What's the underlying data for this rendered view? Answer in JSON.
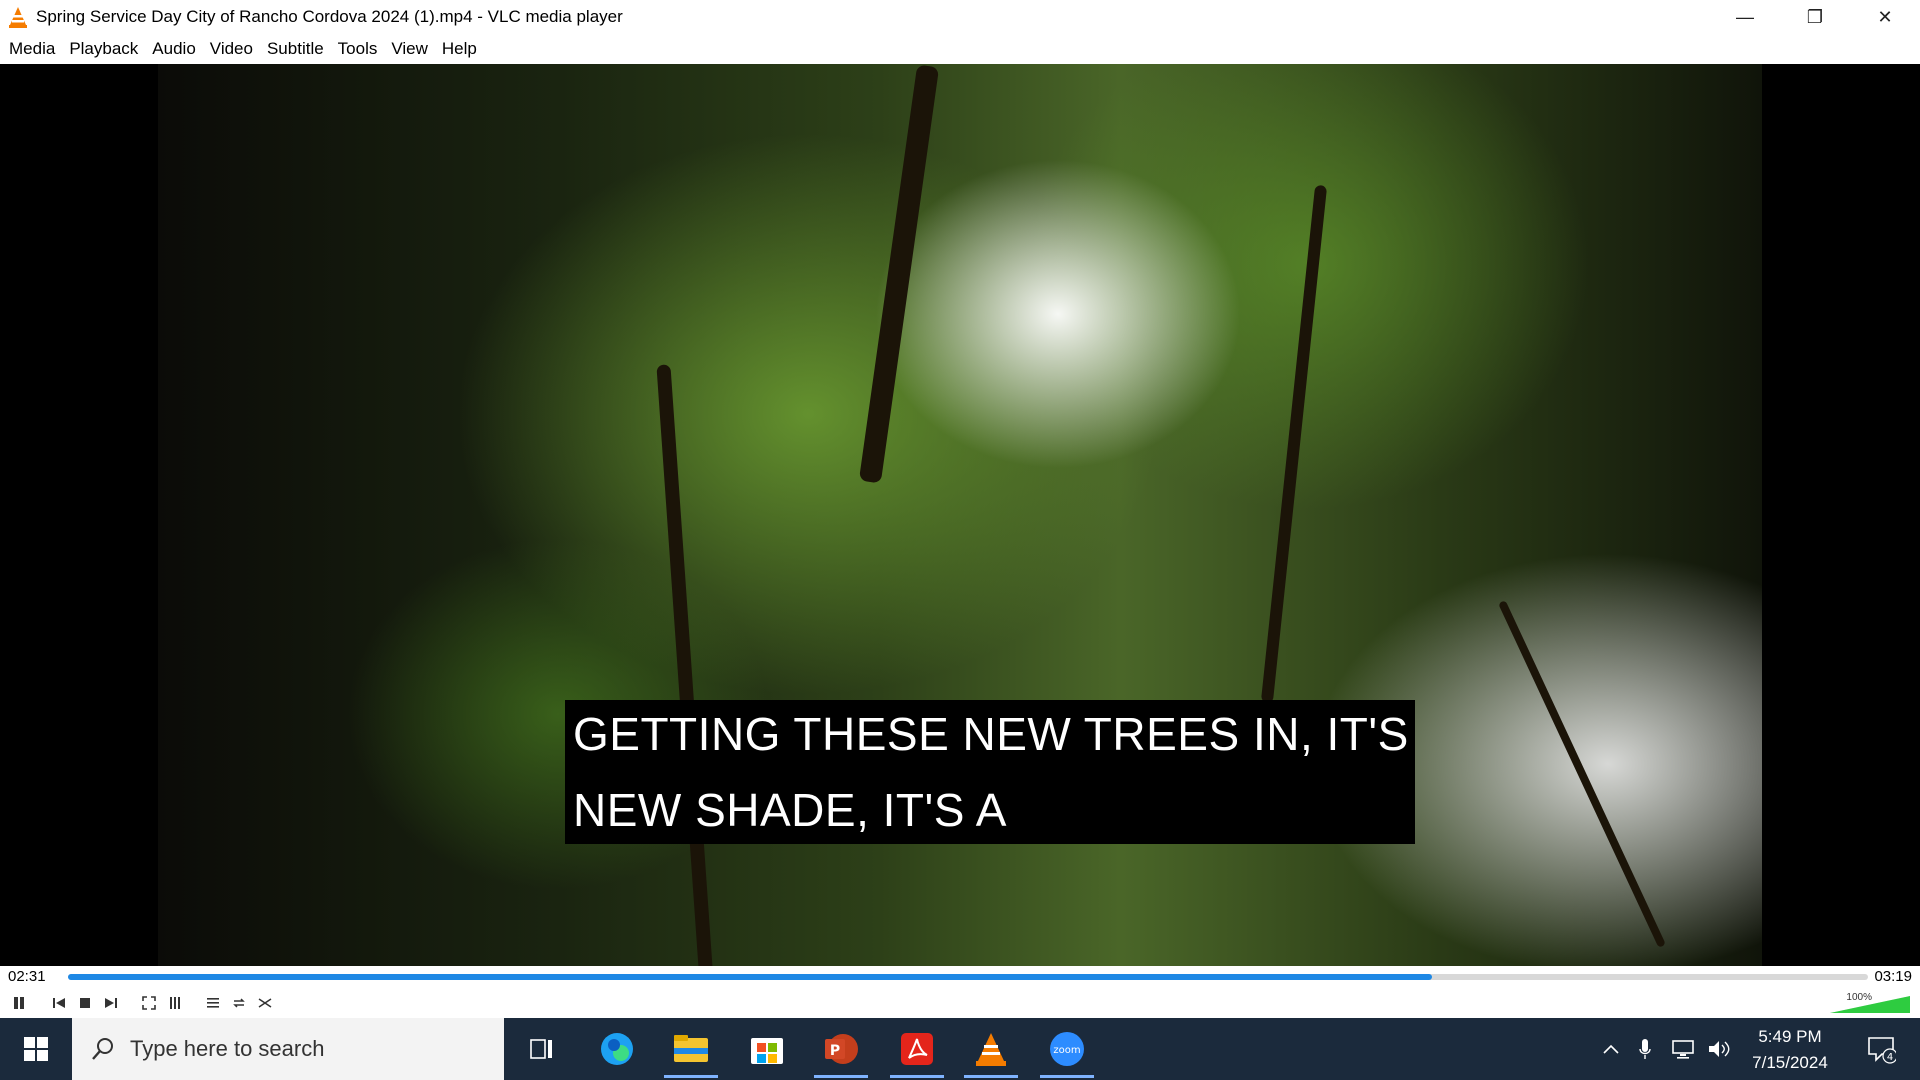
{
  "window": {
    "title": "Spring Service Day City of Rancho Cordova 2024 (1).mp4 - VLC media player",
    "controls": {
      "minimize": "—",
      "restore": "❐",
      "close": "✕"
    }
  },
  "menu": [
    "Media",
    "Playback",
    "Audio",
    "Video",
    "Subtitle",
    "Tools",
    "View",
    "Help"
  ],
  "video": {
    "subtitle_lines": [
      "GETTING THESE NEW TREES IN, IT'S",
      "NEW SHADE, IT'S A"
    ]
  },
  "playback": {
    "elapsed": "02:31",
    "total": "03:19",
    "progress_fraction": 0.758
  },
  "controls": {
    "buttons": [
      "pause-icon",
      "previous-icon",
      "stop-icon",
      "next-icon",
      "fullscreen-icon",
      "extended-settings-icon",
      "playlist-icon",
      "loop-icon",
      "shuffle-icon"
    ],
    "volume_label": "100%",
    "volume_fraction": 1.0
  },
  "taskbar": {
    "search_placeholder": "Type here to search",
    "apps": [
      "task-view-icon",
      "edge-icon",
      "file-explorer-icon",
      "microsoft-store-icon",
      "powerpoint-icon",
      "acrobat-icon",
      "vlc-icon",
      "zoom-icon"
    ],
    "zoom_label": "zoom",
    "time": "5:49 PM",
    "date": "7/15/2024",
    "notification_count": "4"
  },
  "colors": {
    "accent": "#1e88e5",
    "taskbar": "#1b2a3c",
    "vlc_orange": "#f57c00"
  }
}
